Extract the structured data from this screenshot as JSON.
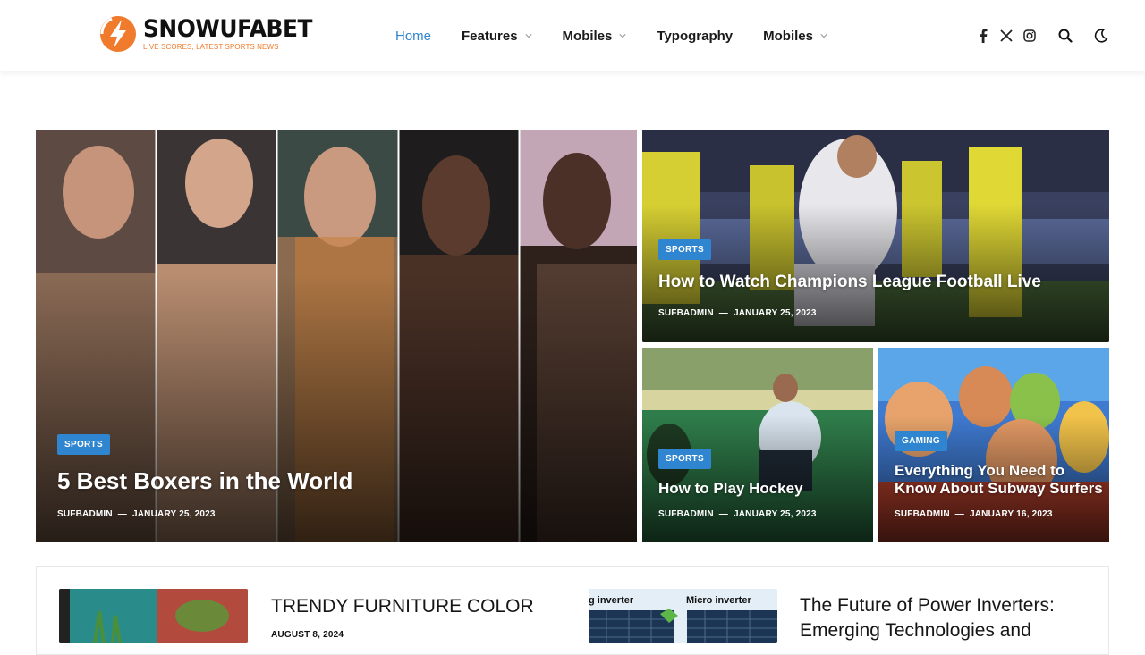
{
  "brand": {
    "name": "SNOWUFABET",
    "tagline": "LIVE SCORES, LATEST SPORTS NEWS",
    "accent": "#f07b2c"
  },
  "nav": {
    "items": [
      {
        "label": "Home",
        "active": true,
        "dropdown": false
      },
      {
        "label": "Features",
        "dropdown": true
      },
      {
        "label": "Mobiles",
        "dropdown": true
      },
      {
        "label": "Typography",
        "dropdown": false
      },
      {
        "label": "Mobiles",
        "dropdown": true
      }
    ]
  },
  "header_icons": [
    "facebook-icon",
    "x-twitter-icon",
    "instagram-icon",
    "search-icon",
    "dark-mode-icon"
  ],
  "colors": {
    "primary": "#2f85cf",
    "text": "#161616"
  },
  "featured": [
    {
      "category": "SPORTS",
      "title": "5 Best Boxers in the World",
      "author": "SUFBADMIN",
      "date": "JANUARY 25, 2023"
    },
    {
      "category": "SPORTS",
      "title": "How to Watch Champions League Football Live",
      "author": "SUFBADMIN",
      "date": "JANUARY 25, 2023"
    },
    {
      "category": "SPORTS",
      "title": "How to Play Hockey",
      "author": "SUFBADMIN",
      "date": "JANUARY 25, 2023"
    },
    {
      "category": "GAMING",
      "title": "Everything You Need to Know About Subway Surfers",
      "author": "SUFBADMIN",
      "date": "JANUARY 16, 2023"
    }
  ],
  "posts": [
    {
      "title": "TRENDY FURNITURE COLOR",
      "date": "AUGUST 8, 2024"
    },
    {
      "title": "The Future of Power Inverters: Emerging Technologies and",
      "thumb_labels": [
        "g inverter",
        "Micro inverter"
      ]
    }
  ]
}
